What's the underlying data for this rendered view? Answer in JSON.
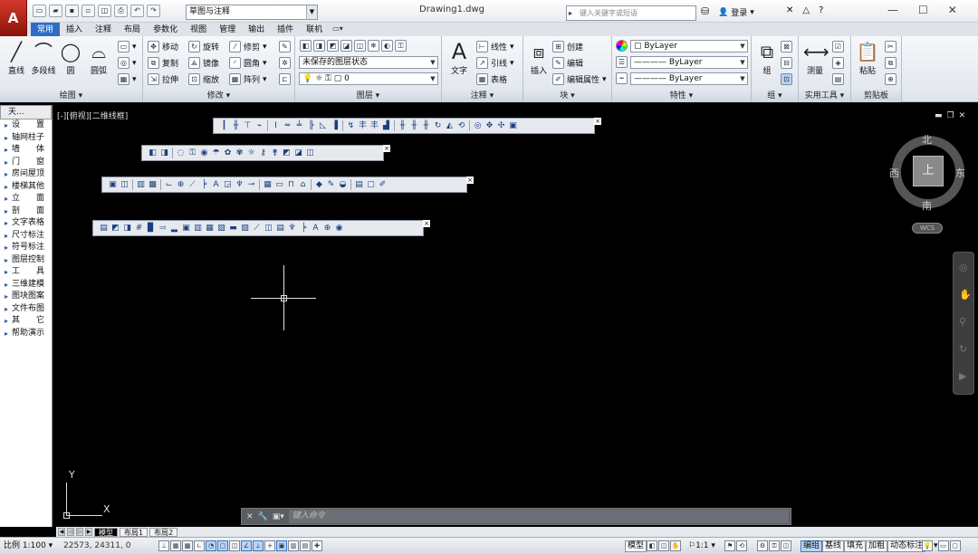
{
  "app": {
    "logo": "A",
    "workspace": "草图与注释",
    "doc_title": "Drawing1.dwg",
    "search_placeholder": "键入关键字或短语",
    "login": "登录",
    "accent_color": "#2e6dc4",
    "canvas_color": "#000000"
  },
  "tabs": [
    "常用",
    "插入",
    "注释",
    "布局",
    "参数化",
    "视图",
    "管理",
    "输出",
    "插件",
    "联机"
  ],
  "active_tab": "常用",
  "ribbon": {
    "draw": {
      "title": "绘图",
      "line": "直线",
      "polyline": "多段线",
      "circle": "圆",
      "arc": "圆弧"
    },
    "modify": {
      "title": "修改",
      "move": "移动",
      "rotate": "旋转",
      "trim": "修剪",
      "copy": "复制",
      "mirror": "镜像",
      "fillet": "圆角",
      "stretch": "拉伸",
      "scale": "缩放",
      "array": "阵列"
    },
    "layers": {
      "title": "图层",
      "layer_state": "未保存的图层状态",
      "current_layer": "0"
    },
    "annotation": {
      "title": "注释",
      "text": "文字",
      "linear": "线性",
      "leader": "引线",
      "table": "表格"
    },
    "block": {
      "title": "块",
      "insert": "插入",
      "create": "创建",
      "edit": "编辑",
      "edit_attr": "编辑属性"
    },
    "properties": {
      "title": "特性",
      "color": "ByLayer",
      "linetype": "ByLayer",
      "lineweight": "ByLayer"
    },
    "groups": {
      "title": "组",
      "group": "组"
    },
    "utilities": {
      "title": "实用工具",
      "measure": "测量"
    },
    "clipboard": {
      "title": "剪贴板",
      "paste": "粘贴"
    }
  },
  "sidebar": {
    "title": "天...",
    "items": [
      "设　　置",
      "轴网柱子",
      "墙　　体",
      "门　　窗",
      "房间屋顶",
      "楼梯其他",
      "立　　面",
      "剖　　面",
      "文字表格",
      "尺寸标注",
      "符号标注",
      "图层控制",
      "工　　具",
      "三维建模",
      "图块图案",
      "文件布图",
      "其　　它",
      "帮助演示"
    ]
  },
  "canvas": {
    "viewport_label": "[-][俯视][二维线框]",
    "ucs_x": "X",
    "ucs_y": "Y",
    "viewcube": {
      "top": "上",
      "north": "北",
      "south": "南",
      "east": "东",
      "west": "西",
      "wcs": "WCS"
    }
  },
  "command_line": {
    "placeholder": "键入命令"
  },
  "layout_tabs": [
    "模型",
    "布局1",
    "布局2"
  ],
  "active_layout": "模型",
  "status": {
    "scale": "比例 1:100",
    "coords": "22573, 24311, 0",
    "model": "模型",
    "annotation_scale": "1:1",
    "edit": "编组",
    "baseline": "基线",
    "fill": "填充",
    "bold": "加粗",
    "dynamic": "动态标注"
  }
}
